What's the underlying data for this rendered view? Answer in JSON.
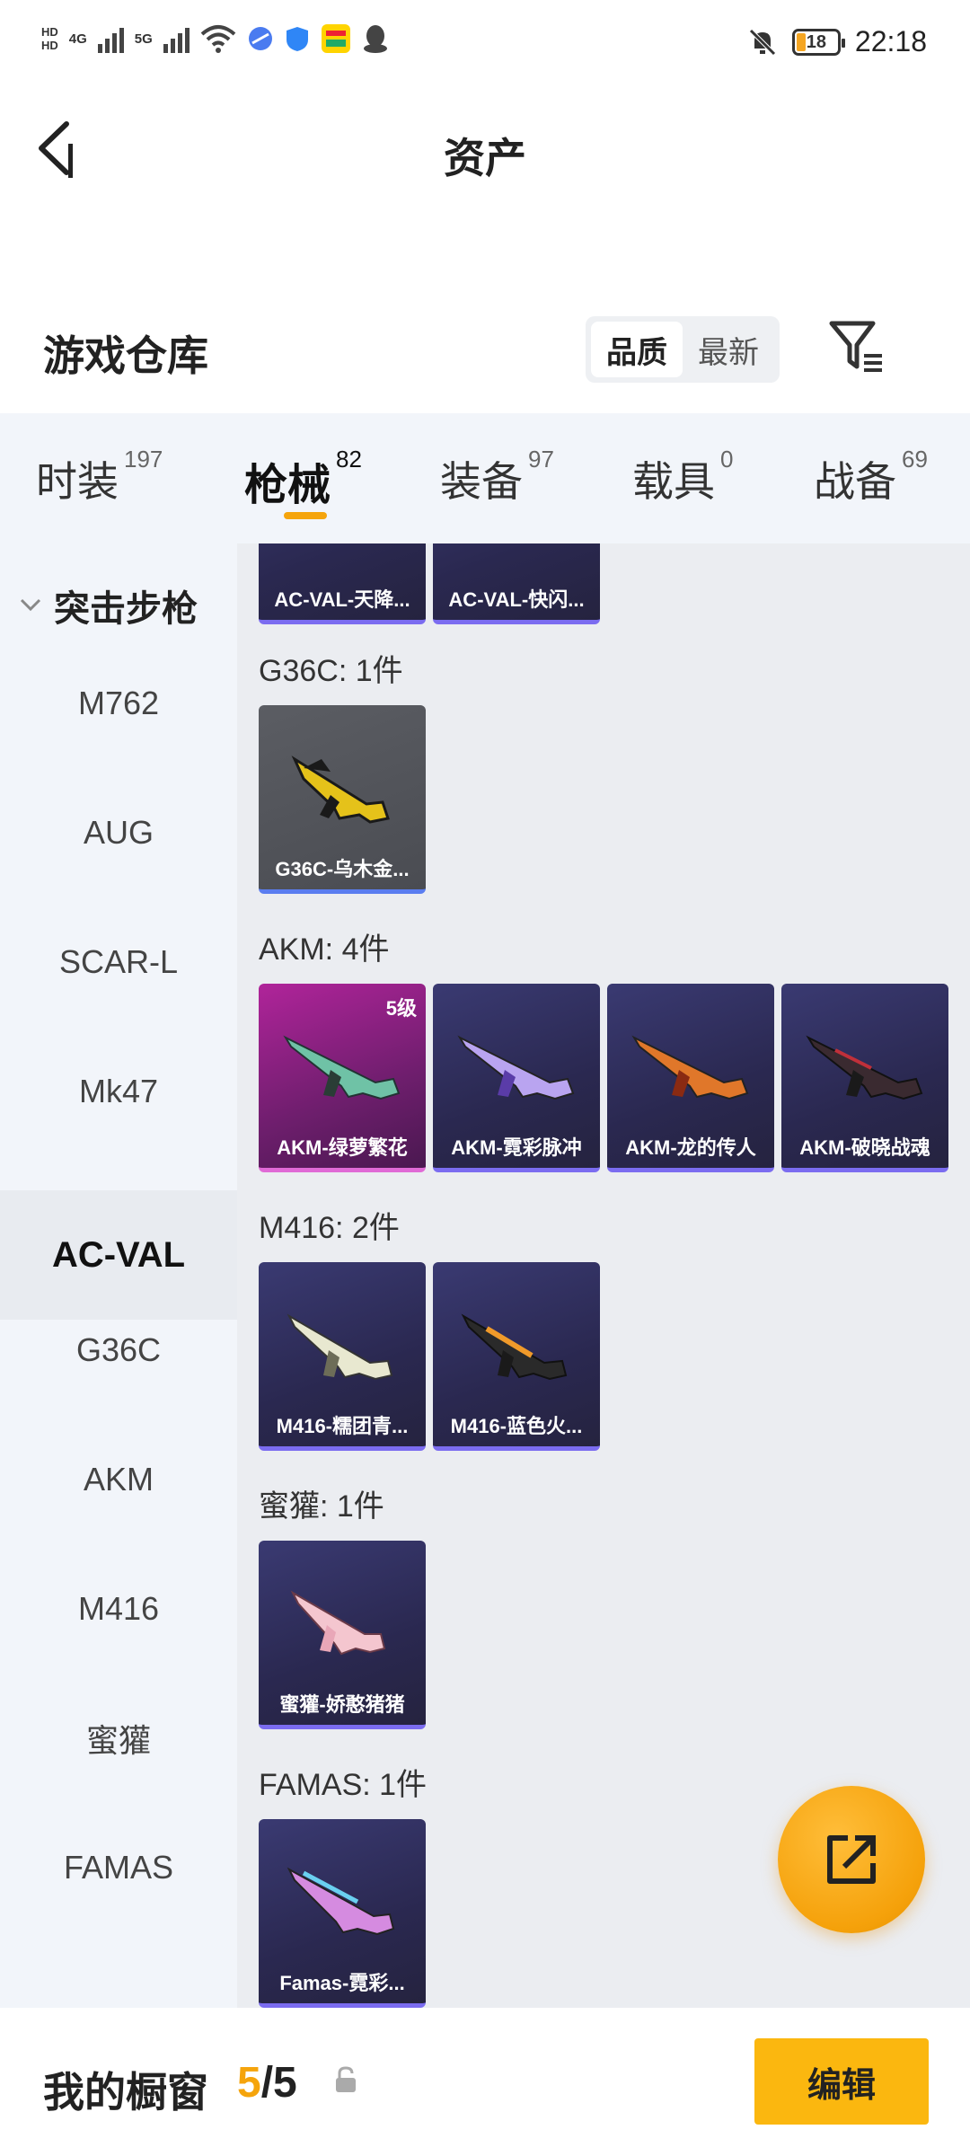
{
  "status_bar": {
    "hd_top": "HD",
    "hd_bottom": "HD",
    "net1": "4G",
    "net2": "5G",
    "battery": "18",
    "time": "22:18"
  },
  "header": {
    "title": "资产"
  },
  "warehouse": {
    "title": "游戏仓库",
    "sort_options": [
      "品质",
      "最新"
    ],
    "active_sort": "品质"
  },
  "tabs": [
    {
      "label": "时装",
      "count": "197"
    },
    {
      "label": "枪械",
      "count": "82"
    },
    {
      "label": "装备",
      "count": "97"
    },
    {
      "label": "载具",
      "count": "0"
    },
    {
      "label": "战备",
      "count": "69"
    }
  ],
  "active_tab": "枪械",
  "sidebar": {
    "group": "突击步枪",
    "items": [
      "M762",
      "AUG",
      "SCAR-L",
      "Mk47",
      "AC-VAL",
      "G36C",
      "AKM",
      "M416",
      "蜜獾",
      "FAMAS"
    ],
    "active": "AC-VAL"
  },
  "sections": [
    {
      "title": "",
      "items": [
        {
          "name": "AC-VAL-天降..."
        },
        {
          "name": "AC-VAL-快闪..."
        }
      ]
    },
    {
      "title": "G36C: 1件",
      "items": [
        {
          "name": "G36C-乌木金..."
        }
      ]
    },
    {
      "title": "AKM: 4件",
      "items": [
        {
          "name": "AKM-绿萝繁花",
          "level": "5级"
        },
        {
          "name": "AKM-霓彩脉冲"
        },
        {
          "name": "AKM-龙的传人"
        },
        {
          "name": "AKM-破晓战魂"
        }
      ]
    },
    {
      "title": "M416: 2件",
      "items": [
        {
          "name": "M416-糯团青..."
        },
        {
          "name": "M416-蓝色火..."
        }
      ]
    },
    {
      "title": "蜜獾: 1件",
      "items": [
        {
          "name": "蜜獾-娇憨猪猪"
        }
      ]
    },
    {
      "title": "FAMAS: 1件",
      "items": [
        {
          "name": "Famas-霓彩..."
        }
      ]
    }
  ],
  "bottom_bar": {
    "title": "我的橱窗",
    "showcase_current": "5",
    "showcase_sep": "/",
    "showcase_total": "5",
    "edit_label": "编辑"
  },
  "colors": {
    "accent": "#f5a40c",
    "edit_button": "#fbb70f"
  },
  "icons": {
    "back": "chevron-left-icon",
    "filter": "filter-icon",
    "share": "share-external-icon",
    "lock": "lock-icon"
  }
}
